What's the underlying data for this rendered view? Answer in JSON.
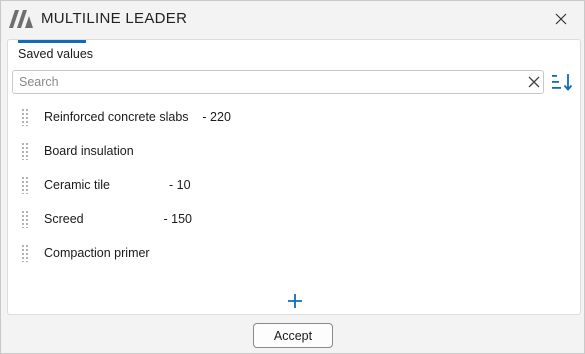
{
  "window": {
    "title": "MULTILINE LEADER"
  },
  "tabs": [
    {
      "label": "Saved values",
      "active": true
    }
  ],
  "search": {
    "placeholder": "Search",
    "value": ""
  },
  "items": [
    {
      "label": "Reinforced concrete slabs    - 220"
    },
    {
      "label": "Board insulation"
    },
    {
      "label": "Ceramic tile                 - 10"
    },
    {
      "label": "Screed                       - 150"
    },
    {
      "label": "Compaction primer"
    }
  ],
  "footer": {
    "accept_label": "Accept"
  },
  "colors": {
    "accent": "#0f6cbd",
    "logo": "#6e6e6e"
  },
  "icons": {
    "logo": "app-logo-icon",
    "close": "close-icon",
    "clear": "clear-search-icon",
    "sort": "sort-icon",
    "drag": "drag-handle-icon",
    "add": "plus-icon"
  }
}
